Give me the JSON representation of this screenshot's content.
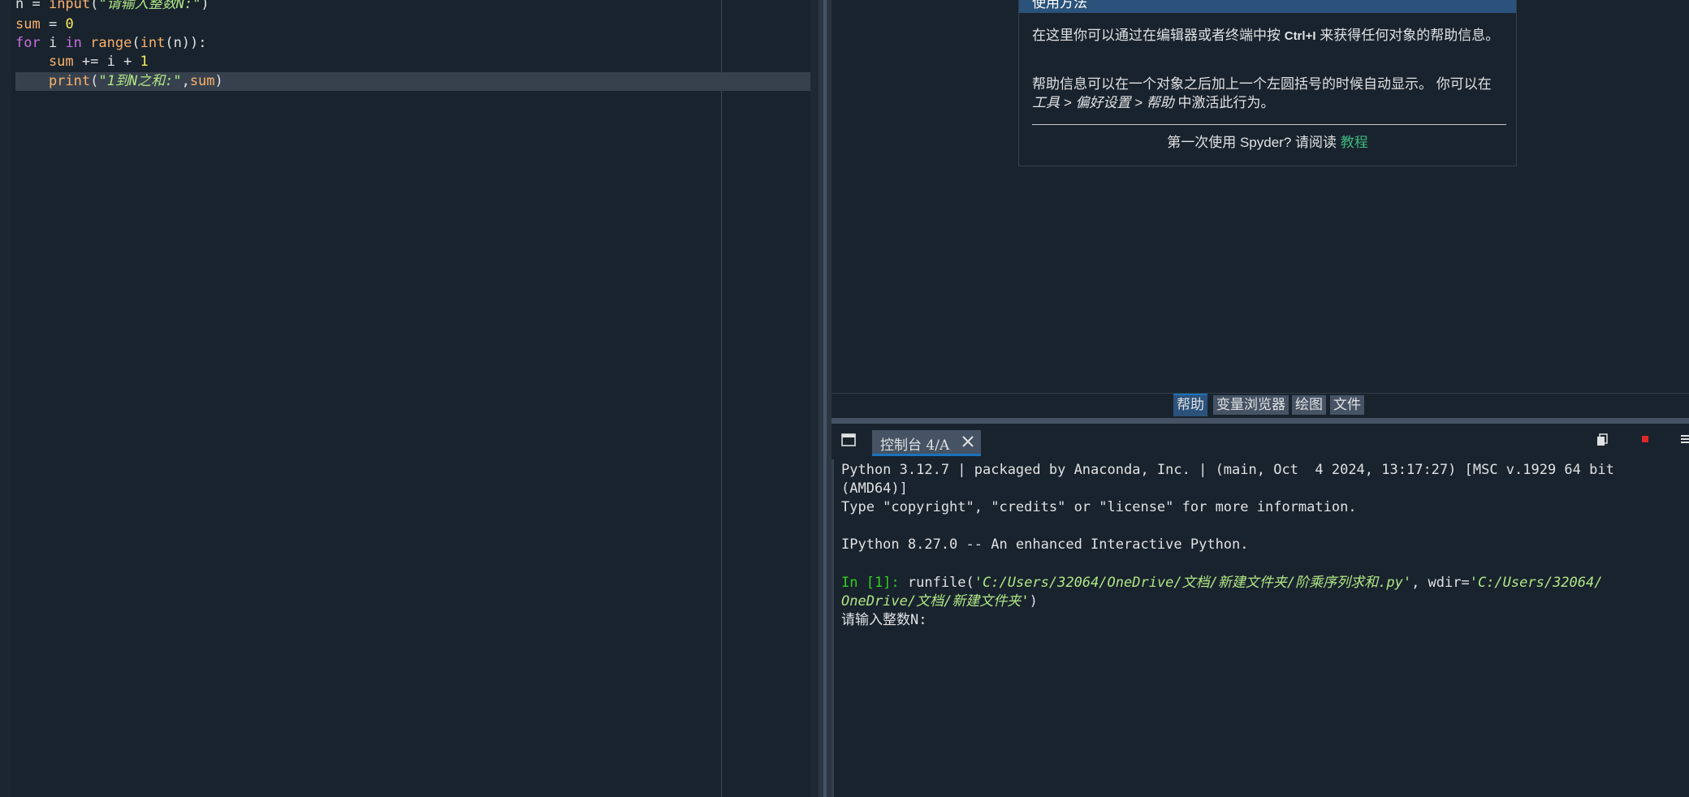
{
  "editor": {
    "lines": [
      {
        "p1": "n = ",
        "p2": "input",
        "p3": "(",
        "p4": "\"请输入整数N:\"",
        "p5": ")"
      },
      {
        "p1": "sum",
        "p2": " = ",
        "p3": "0"
      },
      {
        "p1": "for",
        "p2": " i ",
        "p3": "in",
        "p4": " ",
        "p5": "range",
        "p6": "(",
        "p7": "int",
        "p8": "(n)):"
      },
      {
        "p1": "    sum",
        "p2": " += i + ",
        "p3": "1"
      },
      {
        "p1": "    print",
        "p2": "(",
        "p3": "\"1到N之和:\"",
        "p4": ",",
        "p5": "sum",
        "p6": ")"
      }
    ]
  },
  "help": {
    "title": "使用方法",
    "p1_a": "在这里你可以通过在编辑器或者终端中按 ",
    "p1_key": "Ctrl+I",
    "p1_b": " 来获得任何对象的帮助信息。",
    "p2_a": "帮助信息可以在一个对象之后加上一个左圆括号的时候自动显示。 你可以在 ",
    "p2_em": "工具 > 偏好设置 > 帮助",
    "p2_b": " 中激活此行为。",
    "foot_a": "第一次使用 Spyder? 请阅读 ",
    "foot_link": "教程"
  },
  "help_tabs": [
    "帮助",
    "变量浏览器",
    "绘图",
    "文件"
  ],
  "console": {
    "tab_label": "控制台 4/A",
    "line1": "Python 3.12.7 | packaged by Anaconda, Inc. | (main, Oct  4 2024, 13:17:27) [MSC v.1929 64 bit",
    "line2": "(AMD64)]",
    "line3": "Type \"copyright\", \"credits\" or \"license\" for more information.",
    "line4": "IPython 8.27.0 -- An enhanced Interactive Python.",
    "prompt": "In [1]:",
    "run_a": " runfile(",
    "run_path": "'C:/Users/32064/OneDrive/文档/新建文件夹/阶乘序列求和.py'",
    "run_b": ", wdir=",
    "run_wdir1": "'C:/Users/32064/",
    "run_wdir2": "OneDrive/文档/新建文件夹'",
    "run_c": ")",
    "input_prompt": "请输入整数N:"
  },
  "colors": {
    "background": "#19232d",
    "accent": "#1a72bb",
    "keyword": "#c670e0",
    "string": "#b0e686",
    "number": "#faed5c",
    "prompt": "#32d21f",
    "stop": "#e02828"
  },
  "icons": [
    "window-icon",
    "close-icon",
    "copy-icon",
    "stop-icon",
    "menu-icon"
  ]
}
